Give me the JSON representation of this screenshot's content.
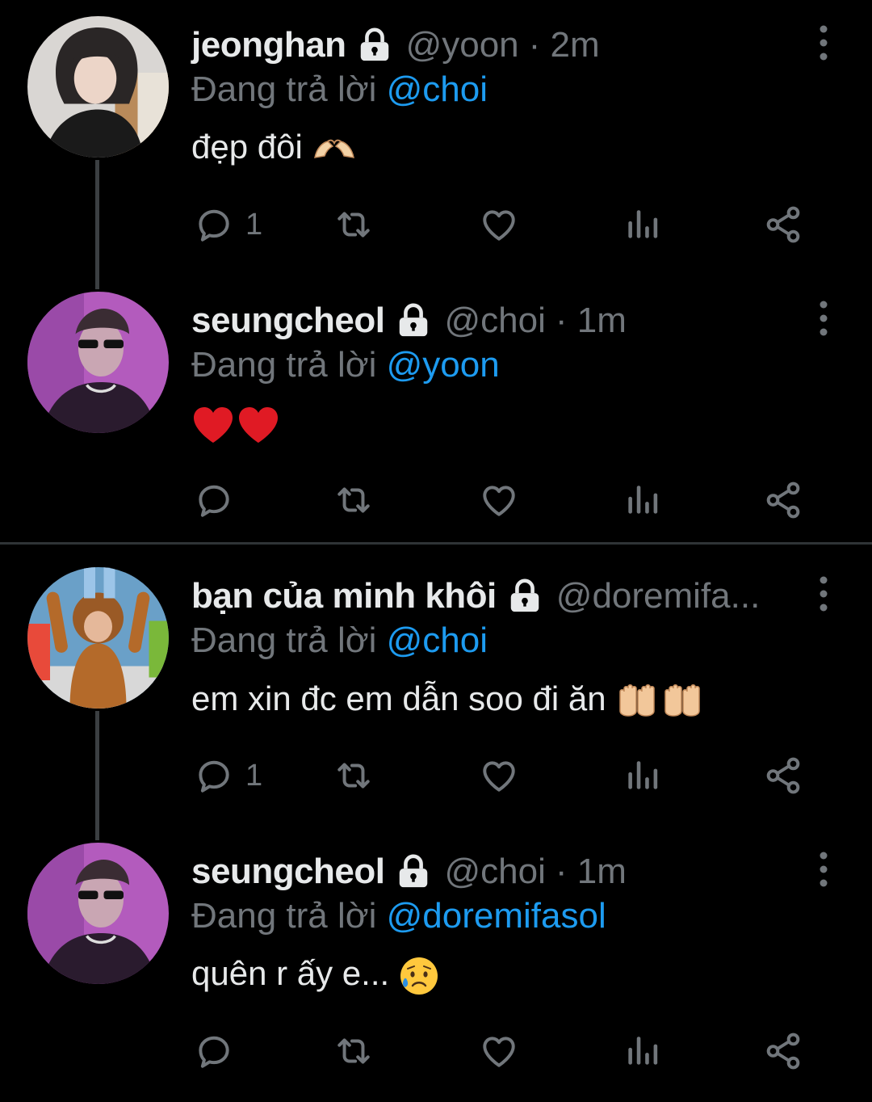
{
  "tweets": [
    {
      "name": "jeonghan",
      "handle": "@yoon",
      "time": "· 2m",
      "reply_prefix": "Đang trả lời",
      "reply_to": "@choi",
      "text": "đẹp đôi",
      "reply_count": "1",
      "icons": {
        "avatar": "avatar-image",
        "emoji": "heart-hands-emoji"
      }
    },
    {
      "name": "seungcheol",
      "handle": "@choi",
      "time": "· 1m",
      "reply_prefix": "Đang trả lời",
      "reply_to": "@yoon",
      "text": "",
      "reply_count": "",
      "icons": {
        "avatar": "avatar-image",
        "emoji": "red-heart-emoji"
      }
    },
    {
      "name": "bạn của minh khôi",
      "handle": "@doremifa...",
      "time": "",
      "reply_prefix": "Đang trả lời",
      "reply_to": "@choi",
      "text": "em xin đc em dẫn soo đi ăn ",
      "reply_count": "1",
      "icons": {
        "avatar": "avatar-image",
        "emoji": "palms-up-emoji"
      }
    },
    {
      "name": "seungcheol",
      "handle": "@choi",
      "time": "· 1m",
      "reply_prefix": "Đang trả lời",
      "reply_to": "@doremifasol",
      "text": "quên r ấy e...",
      "reply_count": "",
      "icons": {
        "avatar": "avatar-image",
        "emoji": "sad-relieved-face-emoji"
      }
    }
  ],
  "colors": {
    "background": "#000000",
    "text": "#e7e9ea",
    "muted": "#71767b",
    "link": "#1d9bf0",
    "divider": "#2f3336"
  }
}
